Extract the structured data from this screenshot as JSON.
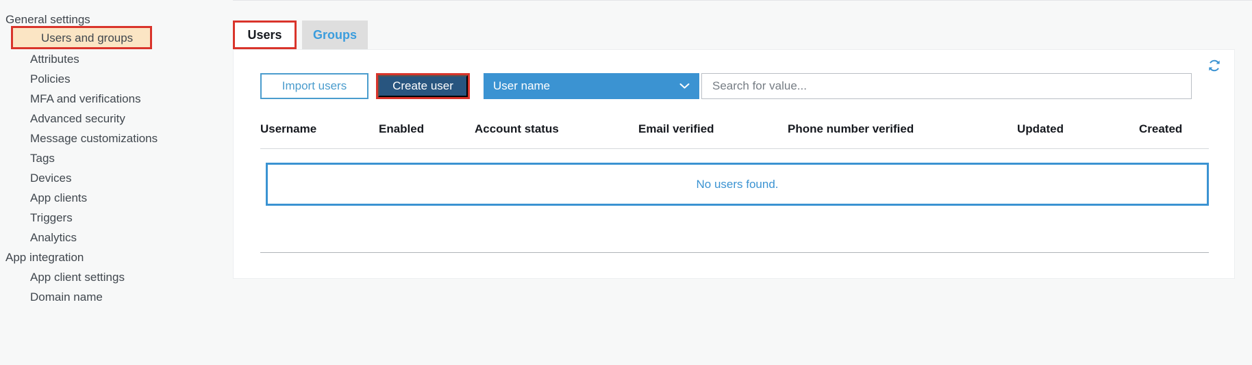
{
  "sidebar": {
    "groups": [
      {
        "title": "General settings",
        "items": [
          {
            "label": "Users and groups",
            "selected": true
          },
          {
            "label": "Attributes",
            "selected": false
          },
          {
            "label": "Policies",
            "selected": false
          },
          {
            "label": "MFA and verifications",
            "selected": false
          },
          {
            "label": "Advanced security",
            "selected": false
          },
          {
            "label": "Message customizations",
            "selected": false
          },
          {
            "label": "Tags",
            "selected": false
          },
          {
            "label": "Devices",
            "selected": false
          },
          {
            "label": "App clients",
            "selected": false
          },
          {
            "label": "Triggers",
            "selected": false
          },
          {
            "label": "Analytics",
            "selected": false
          }
        ]
      },
      {
        "title": "App integration",
        "items": [
          {
            "label": "App client settings",
            "selected": false
          },
          {
            "label": "Domain name",
            "selected": false
          }
        ]
      }
    ]
  },
  "tabs": [
    {
      "label": "Users",
      "active": true
    },
    {
      "label": "Groups",
      "active": false
    }
  ],
  "toolbar": {
    "import_label": "Import users",
    "create_label": "Create user",
    "filter_selected": "User name",
    "filter_options": [
      "User name"
    ],
    "search_placeholder": "Search for value...",
    "search_value": "",
    "refresh_icon": "refresh-icon",
    "chevron_icon": "chevron-down-icon"
  },
  "table": {
    "columns": [
      "Username",
      "Enabled",
      "Account status",
      "Email verified",
      "Phone number verified",
      "Updated",
      "Created"
    ],
    "rows": [],
    "empty_message": "No users found."
  },
  "colors": {
    "accent_blue": "#3b93d2",
    "link_blue": "#4a9ccd",
    "primary_button": "#28557f",
    "highlight_red": "#d9342b",
    "selected_row": "#fbe5c4",
    "page_background": "#f7f8f8"
  }
}
